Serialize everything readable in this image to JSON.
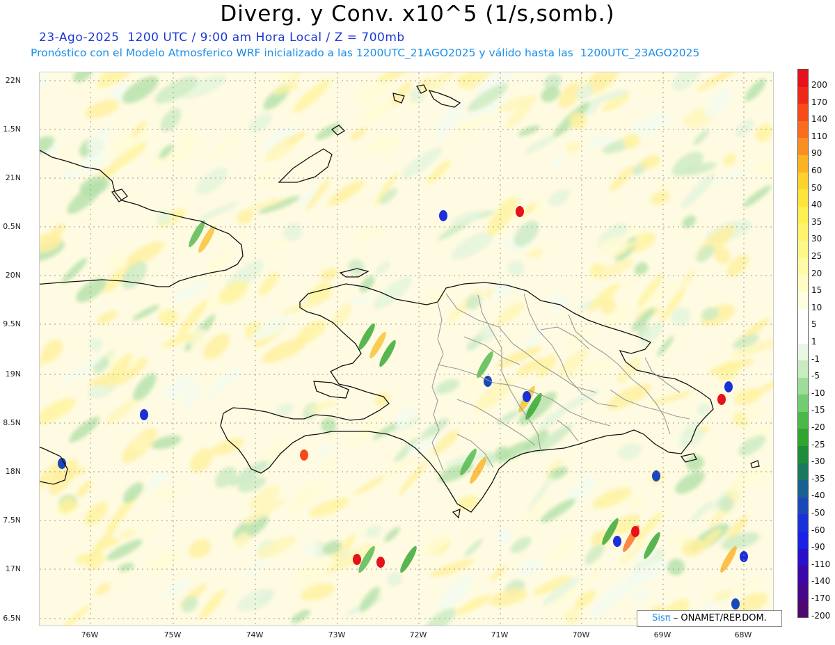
{
  "header": {
    "title": "Diverg. y Conv. x10^5 (1/s,somb.)",
    "subtitle_line1": "23-Ago-2025  1200 UTC / 9:00 am Hora Local / Z = 700mb",
    "subtitle_line2": "Pronóstico con el Modelo Atmosferico WRF inicializado a las 1200UTC_21AGO2025 y válido hasta las  1200UTC_23AGO2025"
  },
  "axes": {
    "lat_labels": [
      "22N",
      "1.5N",
      "21N",
      "0.5N",
      "20N",
      "9.5N",
      "19N",
      "8.5N",
      "18N",
      "7.5N",
      "17N",
      "6.5N"
    ],
    "lon_labels": [
      "76W",
      "75W",
      "74W",
      "73W",
      "72W",
      "71W",
      "70W",
      "69W",
      "68W"
    ]
  },
  "colorbar": {
    "labels": [
      "200",
      "170",
      "140",
      "110",
      "90",
      "60",
      "50",
      "40",
      "35",
      "30",
      "25",
      "20",
      "15",
      "10",
      "5",
      "1",
      "-1",
      "-5",
      "-10",
      "-15",
      "-20",
      "-25",
      "-30",
      "-35",
      "-40",
      "-50",
      "-60",
      "-90",
      "-110",
      "-140",
      "-170",
      "-200"
    ],
    "colors": [
      "#e8101a",
      "#f02818",
      "#f64a18",
      "#f96c1c",
      "#fb8e20",
      "#fdb222",
      "#fdd22a",
      "#ffe43a",
      "#fff050",
      "#fff46c",
      "#fff888",
      "#fffba6",
      "#fffcc4",
      "#fffde0",
      "#ffffff",
      "#ffffff",
      "#e8f6e4",
      "#c6ecc0",
      "#9edd98",
      "#74cc70",
      "#4db84a",
      "#2ea52c",
      "#1c8e3a",
      "#1a7860",
      "#1a6090",
      "#1a48b8",
      "#1a30d8",
      "#1a20e8",
      "#2a10c8",
      "#3a08a8",
      "#46068a",
      "#500670"
    ]
  },
  "credit": {
    "logo": "Sisπ",
    "text": "– ONAMET/REP.DOM."
  }
}
